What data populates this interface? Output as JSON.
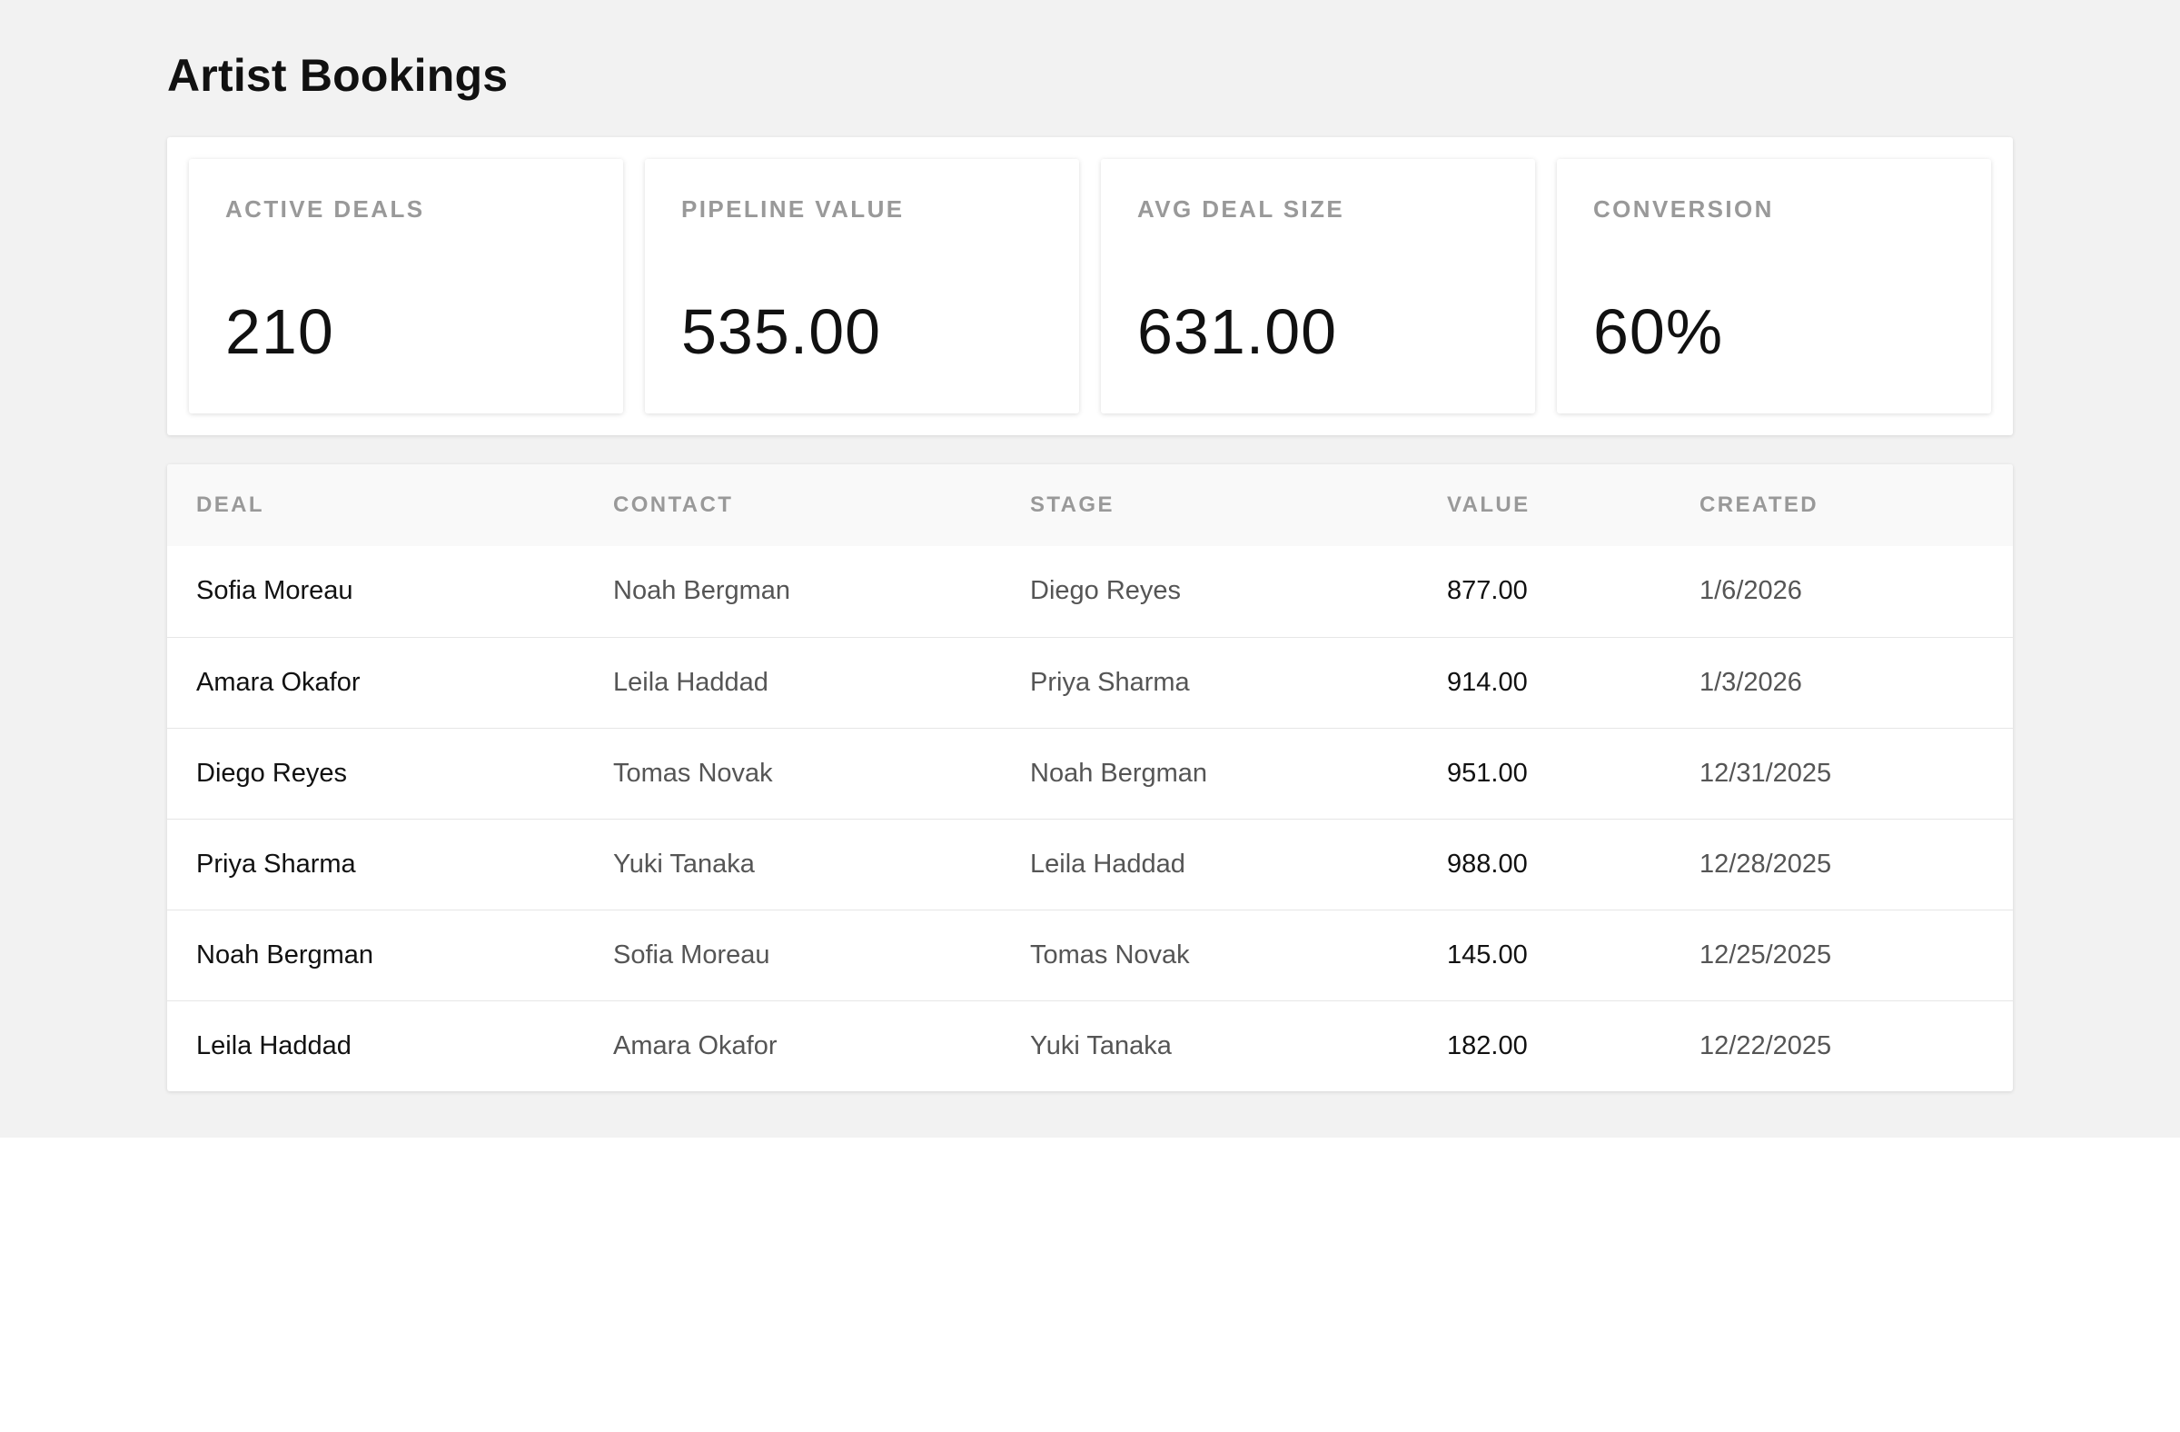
{
  "app": {
    "title": "Artist Bookings"
  },
  "kpis": [
    {
      "label": "ACTIVE DEALS",
      "value": "210"
    },
    {
      "label": "PIPELINE VALUE",
      "value": "535.00"
    },
    {
      "label": "AVG DEAL SIZE",
      "value": "631.00"
    },
    {
      "label": "CONVERSION",
      "value": "60%"
    }
  ],
  "table": {
    "headers": {
      "deal": "DEAL",
      "contact": "CONTACT",
      "stage": "STAGE",
      "value": "VALUE",
      "created": "CREATED"
    },
    "rows": [
      {
        "deal": "Sofia Moreau",
        "contact": "Noah Bergman",
        "stage": "Diego Reyes",
        "value": "877.00",
        "created": "1/6/2026"
      },
      {
        "deal": "Amara Okafor",
        "contact": "Leila Haddad",
        "stage": "Priya Sharma",
        "value": "914.00",
        "created": "1/3/2026"
      },
      {
        "deal": "Diego Reyes",
        "contact": "Tomas Novak",
        "stage": "Noah Bergman",
        "value": "951.00",
        "created": "12/31/2025"
      },
      {
        "deal": "Priya Sharma",
        "contact": "Yuki Tanaka",
        "stage": "Leila Haddad",
        "value": "988.00",
        "created": "12/28/2025"
      },
      {
        "deal": "Noah Bergman",
        "contact": "Sofia Moreau",
        "stage": "Tomas Novak",
        "value": "145.00",
        "created": "12/25/2025"
      },
      {
        "deal": "Leila Haddad",
        "contact": "Amara Okafor",
        "stage": "Yuki Tanaka",
        "value": "182.00",
        "created": "12/22/2025"
      }
    ]
  }
}
